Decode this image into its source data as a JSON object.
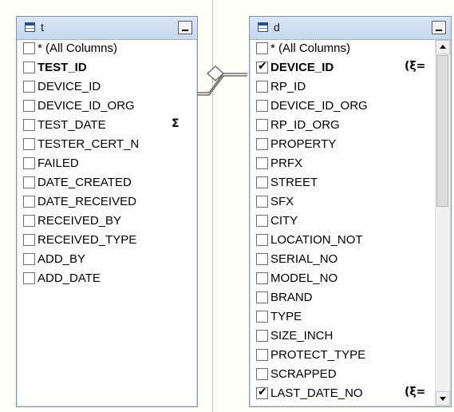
{
  "tables": {
    "t": {
      "name": "t",
      "columns": [
        {
          "label": "* (All Columns)",
          "checked": false,
          "bold": false,
          "glyph": ""
        },
        {
          "label": "TEST_ID",
          "checked": false,
          "bold": true,
          "glyph": ""
        },
        {
          "label": "DEVICE_ID",
          "checked": false,
          "bold": false,
          "glyph": ""
        },
        {
          "label": "DEVICE_ID_ORG",
          "checked": false,
          "bold": false,
          "glyph": ""
        },
        {
          "label": "TEST_DATE",
          "checked": false,
          "bold": false,
          "glyph": "Σ"
        },
        {
          "label": "TESTER_CERT_N",
          "checked": false,
          "bold": false,
          "glyph": ""
        },
        {
          "label": "FAILED",
          "checked": false,
          "bold": false,
          "glyph": ""
        },
        {
          "label": "DATE_CREATED",
          "checked": false,
          "bold": false,
          "glyph": ""
        },
        {
          "label": "DATE_RECEIVED",
          "checked": false,
          "bold": false,
          "glyph": ""
        },
        {
          "label": "RECEIVED_BY",
          "checked": false,
          "bold": false,
          "glyph": ""
        },
        {
          "label": "RECEIVED_TYPE",
          "checked": false,
          "bold": false,
          "glyph": ""
        },
        {
          "label": "ADD_BY",
          "checked": false,
          "bold": false,
          "glyph": ""
        },
        {
          "label": "ADD_DATE",
          "checked": false,
          "bold": false,
          "glyph": ""
        }
      ]
    },
    "d": {
      "name": "d",
      "columns": [
        {
          "label": "* (All Columns)",
          "checked": false,
          "bold": false,
          "glyph": ""
        },
        {
          "label": "DEVICE_ID",
          "checked": true,
          "bold": true,
          "glyph": "(ξ="
        },
        {
          "label": "RP_ID",
          "checked": false,
          "bold": false,
          "glyph": ""
        },
        {
          "label": "DEVICE_ID_ORG",
          "checked": false,
          "bold": false,
          "glyph": ""
        },
        {
          "label": "RP_ID_ORG",
          "checked": false,
          "bold": false,
          "glyph": ""
        },
        {
          "label": "PROPERTY",
          "checked": false,
          "bold": false,
          "glyph": ""
        },
        {
          "label": "PRFX",
          "checked": false,
          "bold": false,
          "glyph": ""
        },
        {
          "label": "STREET",
          "checked": false,
          "bold": false,
          "glyph": ""
        },
        {
          "label": "SFX",
          "checked": false,
          "bold": false,
          "glyph": ""
        },
        {
          "label": "CITY",
          "checked": false,
          "bold": false,
          "glyph": ""
        },
        {
          "label": "LOCATION_NOT",
          "checked": false,
          "bold": false,
          "glyph": ""
        },
        {
          "label": "SERIAL_NO",
          "checked": false,
          "bold": false,
          "glyph": ""
        },
        {
          "label": "MODEL_NO",
          "checked": false,
          "bold": false,
          "glyph": ""
        },
        {
          "label": "BRAND",
          "checked": false,
          "bold": false,
          "glyph": ""
        },
        {
          "label": "TYPE",
          "checked": false,
          "bold": false,
          "glyph": ""
        },
        {
          "label": "SIZE_INCH",
          "checked": false,
          "bold": false,
          "glyph": ""
        },
        {
          "label": "PROTECT_TYPE",
          "checked": false,
          "bold": false,
          "glyph": ""
        },
        {
          "label": "SCRAPPED",
          "checked": false,
          "bold": false,
          "glyph": ""
        },
        {
          "label": "LAST_DATE_NO",
          "checked": true,
          "bold": false,
          "glyph": "(ξ="
        }
      ]
    }
  },
  "icons": {
    "table_icon": "table-grid-icon",
    "minimize": "minimize-icon",
    "join": "join-diamond-icon"
  },
  "colors": {
    "title_bar": "#c7d8ee",
    "window_border": "#7f93ad",
    "canvas": "#fffef6"
  }
}
